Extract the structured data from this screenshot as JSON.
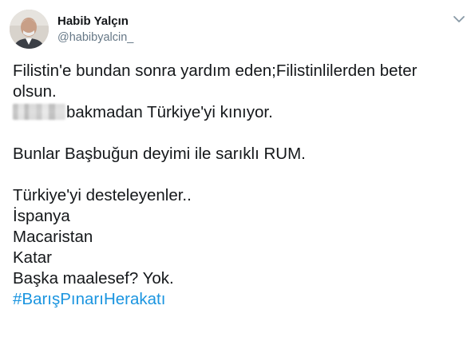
{
  "author": {
    "name": "Habib Yalçın",
    "handle": "@habibyalcin_"
  },
  "icons": {
    "menu": "chevron-down-icon",
    "avatar": "profile-photo"
  },
  "colors": {
    "text": "#14171a",
    "secondary": "#657786",
    "link": "#1b95e0"
  },
  "tweet": {
    "line1": "Filistin'e bundan sonra yardım eden;Filistinlilerden beter",
    "line2": "olsun.",
    "line3_rest": "bakmadan Türkiye'yi kınıyor.",
    "line4": "Bunlar Başbuğun deyimi ile sarıklı RUM.",
    "line5": "Türkiye'yi desteleyenler..",
    "line6": "İspanya",
    "line7": "Macaristan",
    "line8": "Katar",
    "line9": "Başka maalesef? Yok.",
    "hashtag": "#BarışPınarıHerakatı"
  }
}
